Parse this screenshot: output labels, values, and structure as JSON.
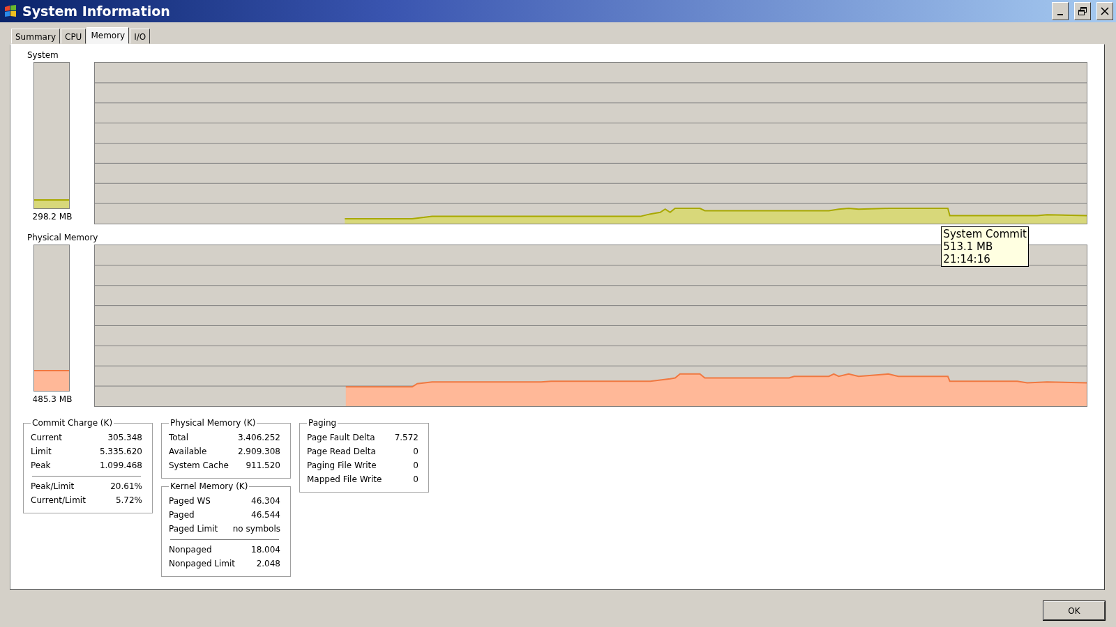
{
  "window": {
    "title": "System Information"
  },
  "tabs": [
    {
      "label": "Summary",
      "selected": false
    },
    {
      "label": "CPU",
      "selected": false
    },
    {
      "label": "Memory",
      "selected": true
    },
    {
      "label": "I/O",
      "selected": false
    }
  ],
  "graphs": [
    {
      "kind": "commit",
      "label": "System",
      "level": 0.06,
      "reading": "298.2 MB",
      "tooltip": {
        "lines": [
          "System Commit",
          "513.1 MB",
          "21:14:16"
        ]
      }
    },
    {
      "kind": "physical",
      "label": "Physical Memory",
      "level": 0.145,
      "reading": "485.3 MB"
    }
  ],
  "stat_columns": [
    [
      {
        "title": "Commit Charge (K)",
        "sections": [
          [
            {
              "label": "Current",
              "value": "305.348"
            },
            {
              "label": "Limit",
              "value": "5.335.620"
            },
            {
              "label": "Peak",
              "value": "1.099.468"
            }
          ],
          [
            {
              "label": "Peak/Limit",
              "value": "20.61%"
            },
            {
              "label": "Current/Limit",
              "value": "5.72%"
            }
          ]
        ]
      }
    ],
    [
      {
        "title": "Physical Memory (K)",
        "sections": [
          [
            {
              "label": "Total",
              "value": "3.406.252"
            },
            {
              "label": "Available",
              "value": "2.909.308"
            },
            {
              "label": "System Cache",
              "value": "911.520"
            }
          ]
        ]
      },
      {
        "title": "Kernel Memory (K)",
        "sections": [
          [
            {
              "label": "Paged WS",
              "value": "46.304"
            },
            {
              "label": "Paged",
              "value": "46.544"
            },
            {
              "label": "Paged Limit",
              "value": "no symbols"
            }
          ],
          [
            {
              "label": "Nonpaged",
              "value": "18.004"
            },
            {
              "label": "Nonpaged Limit",
              "value": "2.048"
            }
          ]
        ]
      }
    ],
    [
      {
        "title": "Paging",
        "sections": [
          [
            {
              "label": "Page Fault Delta",
              "value": "7.572"
            },
            {
              "label": "Page Read Delta",
              "value": "0"
            },
            {
              "label": "Paging File Write",
              "value": "0"
            },
            {
              "label": "Mapped File Write",
              "value": "0"
            }
          ]
        ]
      }
    ]
  ],
  "buttons": [
    "OK"
  ]
}
